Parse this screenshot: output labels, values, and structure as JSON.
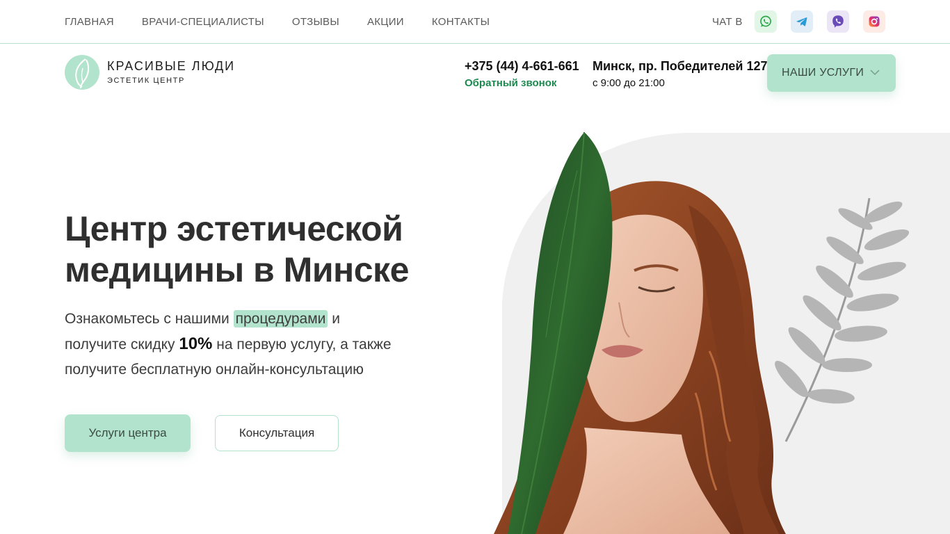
{
  "nav": {
    "items": [
      "ГЛАВНАЯ",
      "ВРАЧИ-СПЕЦИАЛИСТЫ",
      "ОТЗЫВЫ",
      "АКЦИИ",
      "КОНТАКТЫ"
    ]
  },
  "chat": {
    "label": "ЧАТ В",
    "icons": [
      "whatsapp-icon",
      "telegram-icon",
      "viber-icon",
      "instagram-icon"
    ]
  },
  "logo": {
    "title": "КРАСИВЫЕ ЛЮДИ",
    "subtitle": "ЭСТЕТИК ЦЕНТР"
  },
  "contacts": {
    "phone": "+375 (44) 4-661-661",
    "callback": "Обратный звонок",
    "address": "Минск, пр. Победителей 127",
    "hours": "с 9:00 до 21:00"
  },
  "services_menu": {
    "label": "НАШИ УСЛУГИ"
  },
  "hero": {
    "title_line1": "Центр эстетической",
    "title_line2": "медицины в Минске",
    "text_part1": "Ознакомьтесь с нашими",
    "text_highlight": "процедурами",
    "text_part2": "и получите скидку",
    "discount": "10%",
    "text_part3": "на первую услугу, а также получите бесплатную онлайн-консультацию",
    "primary_button": "Услуги центра",
    "secondary_button": "Консультация"
  },
  "colors": {
    "accent": "#b2e3cc",
    "accent_dark": "#1c8a4f",
    "divider": "#b9e2cf",
    "text": "#2f2f2f"
  }
}
